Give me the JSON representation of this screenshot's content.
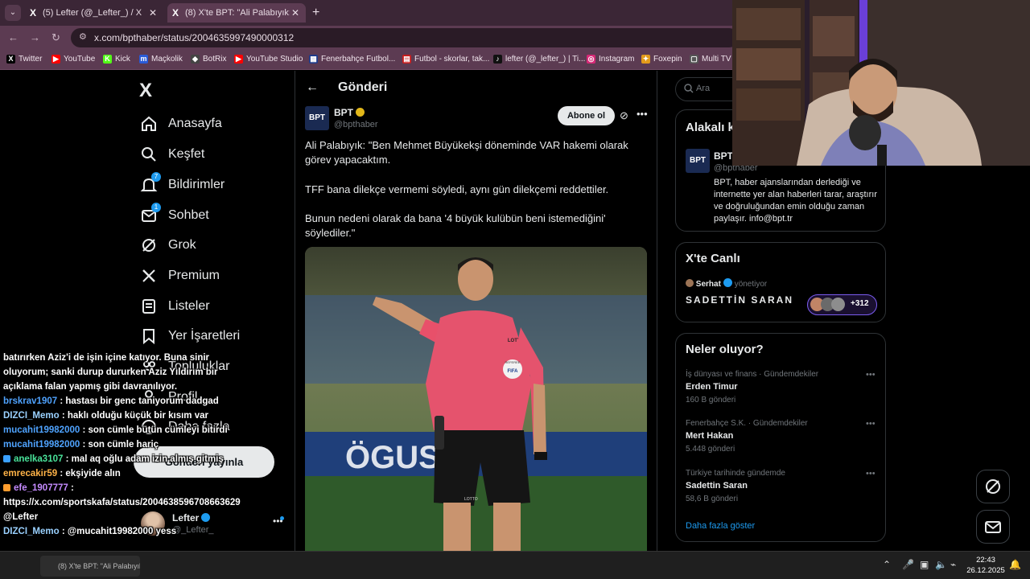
{
  "browser": {
    "tabs": [
      {
        "label": "(5) Lefter (@_Lefter_) / X",
        "icon": "x-icon"
      },
      {
        "label": "(8) X'te BPT: \"Ali Palabıyık: \"Ben",
        "icon": "x-icon"
      }
    ],
    "tab_favicon": "X",
    "tab_close": "✕",
    "new_tab": "+",
    "url": "x.com/bpthaber/status/2004635997490000312",
    "bookmarks": [
      {
        "label": "Twitter",
        "color": "#000000",
        "glyph": "X"
      },
      {
        "label": "YouTube",
        "color": "#ff0000",
        "glyph": "▶"
      },
      {
        "label": "Kick",
        "color": "#53fc18",
        "glyph": "K"
      },
      {
        "label": "Maçkolik",
        "color": "#2a5bd7",
        "glyph": "m"
      },
      {
        "label": "BotRix",
        "color": "#444444",
        "glyph": "◆"
      },
      {
        "label": "YouTube Studio",
        "color": "#ff0000",
        "glyph": "▶"
      },
      {
        "label": "Fenerbahçe Futbol...",
        "color": "#1e3a8a",
        "glyph": "▦"
      },
      {
        "label": "Futbol - skorlar, tak...",
        "color": "#c81e1e",
        "glyph": "▤"
      },
      {
        "label": "lefter (@_lefter_) | Ti...",
        "color": "#111111",
        "glyph": "♪"
      },
      {
        "label": "Instagram",
        "color": "#d62976",
        "glyph": "◎"
      },
      {
        "label": "Foxepin",
        "color": "#e39b1b",
        "glyph": "✦"
      },
      {
        "label": "Multi TV",
        "color": "#555555",
        "glyph": "▢"
      }
    ]
  },
  "x": {
    "logo": "X",
    "nav": [
      {
        "label": "Anasayfa",
        "icon": "home-icon"
      },
      {
        "label": "Keşfet",
        "icon": "search-icon"
      },
      {
        "label": "Bildirimler",
        "icon": "bell-icon",
        "badge": "7"
      },
      {
        "label": "Sohbet",
        "icon": "mail-icon",
        "badge": "1"
      },
      {
        "label": "Grok",
        "icon": "grok-icon"
      },
      {
        "label": "Premium",
        "icon": "x-premium-icon"
      },
      {
        "label": "Listeler",
        "icon": "list-icon"
      },
      {
        "label": "Yer İşaretleri",
        "icon": "bookmark-icon"
      },
      {
        "label": "Topluluklar",
        "icon": "people-icon"
      },
      {
        "label": "Profil",
        "icon": "person-icon"
      },
      {
        "label": "Daha fazla",
        "icon": "more-circle-icon"
      }
    ],
    "post_button": "Gönderi yayınla",
    "account": {
      "name": "Lefter",
      "handle": "@_Lefter_",
      "more": "•••"
    }
  },
  "post": {
    "header_title": "Gönderi",
    "author_logo": "BPT",
    "author_name": "BPT",
    "author_handle": "@bpthaber",
    "follow_label": "Abone ol",
    "more": "•••",
    "paragraphs": [
      "Ali Palabıyık: \"Ben Mehmet Büyükekşi döneminde VAR hakemi olarak görev yapacaktım.",
      "TFF bana dilekçe vermemi söyledi, aynı gün dilekçemi reddettiler.",
      "Bunun nedeni olarak da bana '4 büyük kulübün beni istemediğini' söylediler.\""
    ],
    "image_text": {
      "banner": "ÖGUS",
      "badge": "FIFA",
      "badge_top": "REFEREE",
      "lotto": "LOTTO"
    }
  },
  "sidebar": {
    "search_placeholder": "Ara",
    "related": {
      "title": "Alakalı kişiler",
      "name": "BPT",
      "handle": "@bpthaber",
      "bio": "BPT, haber ajanslarından derlediği ve internette yer alan haberleri tarar, araştırır ve doğruluğundan emin olduğu zaman paylaşır. info@bpt.tr"
    },
    "live": {
      "title": "X'te Canlı",
      "host": "Serhat",
      "role": "yönetiyor",
      "space_title": "SADETTİN SARAN",
      "listeners": "+312"
    },
    "trends": {
      "title": "Neler oluyor?",
      "items": [
        {
          "meta": "İş dünyası ve finans · Gündemdekiler",
          "name": "Erden Timur",
          "count": "160 B gönderi"
        },
        {
          "meta": "Fenerbahçe S.K. · Gündemdekiler",
          "name": "Mert Hakan",
          "count": "5.448 gönderi"
        },
        {
          "meta": "Türkiye tarihinde gündemde",
          "name": "Sadettin Saran",
          "count": "58,6 B gönderi"
        }
      ],
      "more_icon": "•••",
      "show_more": "Daha fazla göster"
    }
  },
  "chat": [
    {
      "user": "",
      "msg": "batırırken Aziz'i de işin içine katıyor. Buna sinir oluyorum; sanki durup dururken Aziz Yıldırım bir açıklama falan yapmış gibi davranılıyor.",
      "color": "#ffffff"
    },
    {
      "user": "brskrav1907",
      "msg": " : hastası bir genc taniyorum dadgad",
      "color": "#4fa3ff"
    },
    {
      "user": "DIZCI_Memo",
      "msg": " : haklı olduğu küçük bir kısım var",
      "color": "#9ad1ff"
    },
    {
      "user": "mucahit19982000",
      "msg": " : son cümle bütün cümleyi bitirdi",
      "color": "#4fa3ff"
    },
    {
      "user": "mucahit19982000",
      "msg": " : son cümle hariç",
      "color": "#4fa3ff"
    },
    {
      "user": "anelka3107",
      "msg": " : mal aq oğlu adam izin almış gitmiş",
      "color": "#49e39a",
      "badge": "#3aa0ff"
    },
    {
      "user": "emrecakir59",
      "msg": " : ekşiyide alın",
      "color": "#ffb347"
    },
    {
      "user": "efe_1907777",
      "msg": " : https://x.com/sportskafa/status/2004638596708663629 @Lefter",
      "color": "#c58bff",
      "badge": "#ff9d2e"
    },
    {
      "user": "DIZCI_Memo",
      "msg": " : @mucahit19982000 yess",
      "color": "#9ad1ff"
    }
  ],
  "taskbar": {
    "app_label": "(8) X'te BPT: \"Ali Palabıyık",
    "time": "22:43",
    "date": "26.12.2025"
  }
}
